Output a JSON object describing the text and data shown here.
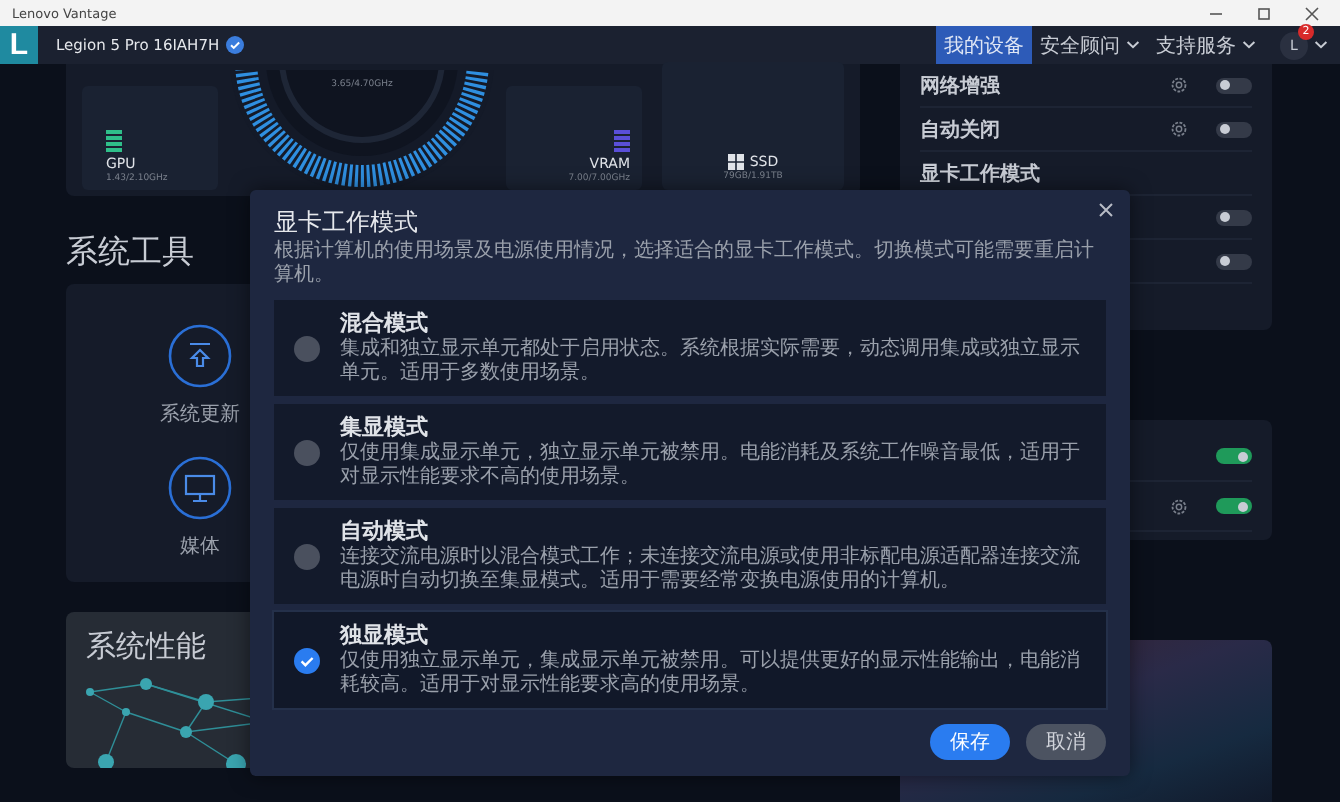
{
  "window": {
    "title": "Lenovo Vantage"
  },
  "header": {
    "logo": "L",
    "device": "Legion 5 Pro 16IAH7H",
    "verified": true,
    "nav": [
      {
        "label": "我的设备",
        "selected": true,
        "dropdown": false
      },
      {
        "label": "安全顾问",
        "selected": false,
        "dropdown": true
      },
      {
        "label": "支持服务",
        "selected": false,
        "dropdown": true
      }
    ],
    "account": {
      "initial": "L",
      "badge": "2"
    }
  },
  "hardware": {
    "cpu_reading": "3.65/4.70GHz",
    "gpu": {
      "label": "GPU",
      "reading": "1.43/2.10GHz"
    },
    "vram": {
      "label": "VRAM",
      "reading": "7.00/7.00GHz"
    },
    "ssd": {
      "label": "SSD",
      "reading": "79GB/1.91TB"
    }
  },
  "tools": {
    "title": "系统工具",
    "items": [
      {
        "label": "系统更新",
        "kind": "update"
      },
      {
        "label": "媒体",
        "kind": "monitor"
      }
    ]
  },
  "performance": {
    "title": "系统性能"
  },
  "settings": [
    {
      "label": "网络增强",
      "gear": true,
      "on": false
    },
    {
      "label": "自动关闭",
      "gear": true,
      "on": false
    },
    {
      "label": "显卡工作模式"
    },
    {
      "on": false
    },
    {
      "on": false
    }
  ],
  "settings_2": [
    {
      "gear": false,
      "on": true
    },
    {
      "gear": true,
      "on": true
    }
  ],
  "dialog": {
    "title": "显卡工作模式",
    "subtitle": "根据计算机的使用场景及电源使用情况，选择适合的显卡工作模式。切换模式可能需要重启计算机。",
    "options": [
      {
        "title": "混合模式",
        "description": "集成和独立显示单元都处于启用状态。系统根据实际需要，动态调用集成或独立显示单元。适用于多数使用场景。",
        "selected": false
      },
      {
        "title": "集显模式",
        "description": "仅使用集成显示单元，独立显示单元被禁用。电能消耗及系统工作噪音最低，适用于对显示性能要求不高的使用场景。",
        "selected": false
      },
      {
        "title": "自动模式",
        "description": "连接交流电源时以混合模式工作；未连接交流电源或使用非标配电源适配器连接交流电源时自动切换至集显模式。适用于需要经常变换电源使用的计算机。",
        "selected": false
      },
      {
        "title": "独显模式",
        "description": "仅使用独立显示单元，集成显示单元被禁用。可以提供更好的显示性能输出，电能消耗较高。适用于对显示性能要求高的使用场景。",
        "selected": true
      }
    ],
    "buttons": [
      {
        "label": "保存",
        "kind": "primary"
      },
      {
        "label": "取消",
        "kind": "secondary"
      }
    ]
  }
}
